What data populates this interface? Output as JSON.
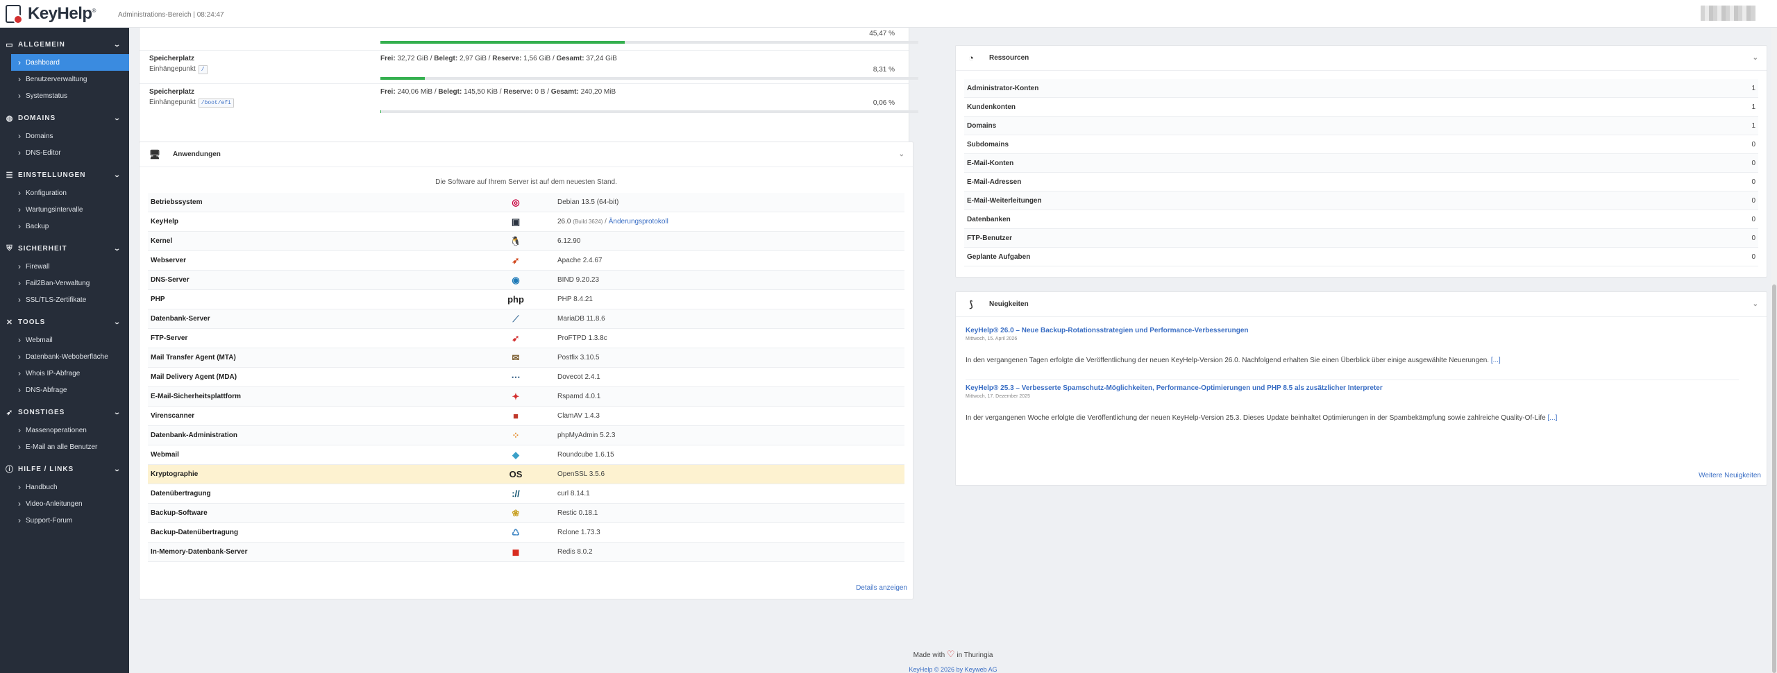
{
  "header": {
    "logo_text": "KeyHelp",
    "logo_reg": "®",
    "admin_area": "Administrations-Bereich | 08:24:47"
  },
  "sidebar": {
    "sections": [
      {
        "label": "ALLGEMEIN",
        "items": [
          "Dashboard",
          "Benutzerverwaltung",
          "Systemstatus"
        ]
      },
      {
        "label": "DOMAINS",
        "items": [
          "Domains",
          "DNS-Editor"
        ]
      },
      {
        "label": "EINSTELLUNGEN",
        "items": [
          "Konfiguration",
          "Wartungsintervalle",
          "Backup"
        ]
      },
      {
        "label": "SICHERHEIT",
        "items": [
          "Firewall",
          "Fail2Ban-Verwaltung",
          "SSL/TLS-Zertifikate"
        ]
      },
      {
        "label": "TOOLS",
        "items": [
          "Webmail",
          "Datenbank-Weboberfläche",
          "Whois IP-Abfrage",
          "DNS-Abfrage"
        ]
      },
      {
        "label": "SONSTIGES",
        "items": [
          "Massenoperationen",
          "E-Mail an alle Benutzer"
        ]
      },
      {
        "label": "HILFE / LINKS",
        "items": [
          "Handbuch",
          "Video-Anleitungen",
          "Support-Forum"
        ]
      }
    ]
  },
  "storage": {
    "top_percent": "45,47 %",
    "top_percent_value": 45.47,
    "rows": [
      {
        "title": "Speicherplatz",
        "mount_label": "Einhängepunkt",
        "mount": "/",
        "frei_label": "Frei:",
        "frei": "32,72 GiB",
        "belegt_label": "Belegt:",
        "belegt": "2,97 GiB",
        "reserve_label": "Reserve:",
        "reserve": "1,56 GiB",
        "gesamt_label": "Gesamt:",
        "gesamt": "37,24 GiB",
        "percent": "8,31 %",
        "percent_value": 8.31
      },
      {
        "title": "Speicherplatz",
        "mount_label": "Einhängepunkt",
        "mount": "/boot/efi",
        "frei_label": "Frei:",
        "frei": "240,06 MiB",
        "belegt_label": "Belegt:",
        "belegt": "145,50 KiB",
        "reserve_label": "Reserve:",
        "reserve": "0 B",
        "gesamt_label": "Gesamt:",
        "gesamt": "240,20 MiB",
        "percent": "0,06 %",
        "percent_value": 0.06
      }
    ]
  },
  "applications": {
    "title": "Anwendungen",
    "status_text": "Die Software auf Ihrem Server ist auf dem neuesten Stand.",
    "rows": [
      {
        "name": "Betriebssystem",
        "icon": "debian-icon",
        "glyph": "◎",
        "color": "#c7003d",
        "version": "Debian 13.5 (64-bit)"
      },
      {
        "name": "KeyHelp",
        "icon": "keyhelp-icon",
        "glyph": "▣",
        "color": "#2a3340",
        "version": "26.0",
        "build": "(Build 3624)",
        "link": "Änderungsprotokoll"
      },
      {
        "name": "Kernel",
        "icon": "linux-icon",
        "glyph": "🐧",
        "color": "#222",
        "version": "6.12.90"
      },
      {
        "name": "Webserver",
        "icon": "apache-icon",
        "glyph": "➶",
        "color": "#d0451b",
        "version": "Apache 2.4.67"
      },
      {
        "name": "DNS-Server",
        "icon": "bind-icon",
        "glyph": "◉",
        "color": "#1e7ab8",
        "version": "BIND 9.20.23"
      },
      {
        "name": "PHP",
        "icon": "php-icon",
        "glyph": "php",
        "color": "#222",
        "version": "PHP 8.4.21"
      },
      {
        "name": "Datenbank-Server",
        "icon": "mariadb-icon",
        "glyph": "⟋",
        "color": "#4b79a1",
        "version": "MariaDB 11.8.6"
      },
      {
        "name": "FTP-Server",
        "icon": "proftpd-icon",
        "glyph": "➹",
        "color": "#d32f2f",
        "version": "ProFTPD 1.3.8c"
      },
      {
        "name": "Mail Transfer Agent (MTA)",
        "icon": "postfix-icon",
        "glyph": "✉",
        "color": "#7a5c2e",
        "version": "Postfix 3.10.5"
      },
      {
        "name": "Mail Delivery Agent (MDA)",
        "icon": "dovecot-icon",
        "glyph": "⋯",
        "color": "#1f4e79",
        "version": "Dovecot 2.4.1"
      },
      {
        "name": "E-Mail-Sicherheitsplattform",
        "icon": "rspamd-icon",
        "glyph": "✦",
        "color": "#d32f2f",
        "version": "Rspamd 4.0.1"
      },
      {
        "name": "Virenscanner",
        "icon": "clamav-icon",
        "glyph": "■",
        "color": "#c0392b",
        "version": "ClamAV 1.4.3"
      },
      {
        "name": "Datenbank-Administration",
        "icon": "phpmyadmin-icon",
        "glyph": "⁘",
        "color": "#e58b2a",
        "version": "phpMyAdmin 5.2.3"
      },
      {
        "name": "Webmail",
        "icon": "roundcube-icon",
        "glyph": "◆",
        "color": "#3aa0c8",
        "version": "Roundcube 1.6.15"
      },
      {
        "name": "Kryptographie",
        "icon": "openssl-icon",
        "glyph": "OS",
        "color": "#222",
        "version": "OpenSSL 3.5.6",
        "highlight": true
      },
      {
        "name": "Datenübertragung",
        "icon": "curl-icon",
        "glyph": "://",
        "color": "#0b4f6c",
        "version": "curl 8.14.1"
      },
      {
        "name": "Backup-Software",
        "icon": "restic-icon",
        "glyph": "❀",
        "color": "#c9a227",
        "version": "Restic 0.18.1"
      },
      {
        "name": "Backup-Datenübertragung",
        "icon": "rclone-icon",
        "glyph": "♺",
        "color": "#3f86c4",
        "version": "Rclone 1.73.3"
      },
      {
        "name": "In-Memory-Datenbank-Server",
        "icon": "redis-icon",
        "glyph": "◼",
        "color": "#d82c20",
        "version": "Redis 8.0.2"
      }
    ],
    "details_link": "Details anzeigen"
  },
  "resources": {
    "title": "Ressourcen",
    "rows": [
      {
        "name": "Administrator-Konten",
        "value": "1"
      },
      {
        "name": "Kundenkonten",
        "value": "1"
      },
      {
        "name": "Domains",
        "value": "1"
      },
      {
        "name": "Subdomains",
        "value": "0"
      },
      {
        "name": "E-Mail-Konten",
        "value": "0"
      },
      {
        "name": "E-Mail-Adressen",
        "value": "0"
      },
      {
        "name": "E-Mail-Weiterleitungen",
        "value": "0"
      },
      {
        "name": "Datenbanken",
        "value": "0"
      },
      {
        "name": "FTP-Benutzer",
        "value": "0"
      },
      {
        "name": "Geplante Aufgaben",
        "value": "0"
      }
    ]
  },
  "news": {
    "title": "Neuigkeiten",
    "items": [
      {
        "title": "KeyHelp® 26.0 – Neue Backup-Rotationsstrategien und Performance-Verbesserungen",
        "date": "Mittwoch, 15. April 2026",
        "text": "In den vergangenen Tagen erfolgte die Veröffentlichung der neuen KeyHelp-Version 26.0. Nachfolgend erhalten Sie einen Überblick über einige ausgewählte Neuerungen.",
        "more": "[...]"
      },
      {
        "title": "KeyHelp® 25.3 – Verbesserte Spamschutz-Möglichkeiten, Performance-Optimierungen und PHP 8.5 als zusätzlicher Interpreter",
        "date": "Mittwoch, 17. Dezember 2025",
        "text": "In der vergangenen Woche erfolgte die Veröffentlichung der neuen KeyHelp-Version 25.3. Dieses Update beinhaltet Optimierungen in der Spambekämpfung sowie zahlreiche Quality-Of-Life",
        "more": "[...]"
      }
    ],
    "more_link": "Weitere Neuigkeiten"
  },
  "footer": {
    "made_with": "Made with",
    "heart": "♡",
    "in": "in Thuringia",
    "copyright": "KeyHelp © 2026 by Keyweb AG"
  }
}
